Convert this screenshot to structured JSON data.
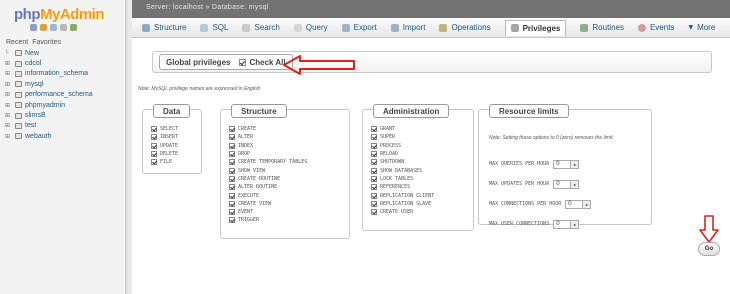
{
  "nav": {
    "logo": {
      "php": "php",
      "myadmin": "MyAdmin"
    },
    "tabs": {
      "recent": "Recent",
      "favorites": "Favorites"
    },
    "new_item": "New",
    "databases": [
      "cdcol",
      "information_schema",
      "mysql",
      "performance_schema",
      "phpmyadmin",
      "slimsB",
      "test",
      "webauth"
    ]
  },
  "breadcrumb": "Server: localhost » Database: mysql",
  "tabs": [
    {
      "label": "Structure",
      "icon": "structure-icon"
    },
    {
      "label": "SQL",
      "icon": "sql-icon"
    },
    {
      "label": "Search",
      "icon": "search-icon"
    },
    {
      "label": "Query",
      "icon": "query-icon"
    },
    {
      "label": "Export",
      "icon": "export-icon"
    },
    {
      "label": "Import",
      "icon": "import-icon"
    },
    {
      "label": "Operations",
      "icon": "operations-icon"
    },
    {
      "label": "Privileges",
      "icon": "privileges-icon"
    },
    {
      "label": "Routines",
      "icon": "routines-icon"
    },
    {
      "label": "Events",
      "icon": "events-icon"
    },
    {
      "label": "More",
      "icon": "more-icon"
    }
  ],
  "global_privileges": {
    "title": "Global privileges",
    "check_all": "Check All"
  },
  "note": "Note: MySQL privilege names are expressed in English",
  "groups": {
    "data": {
      "title": "Data",
      "items": [
        "SELECT",
        "INSERT",
        "UPDATE",
        "DELETE",
        "FILE"
      ]
    },
    "structure": {
      "title": "Structure",
      "items": [
        "CREATE",
        "ALTER",
        "INDEX",
        "DROP",
        "CREATE TEMPORARY TABLES",
        "SHOW VIEW",
        "CREATE ROUTINE",
        "ALTER ROUTINE",
        "EXECUTE",
        "CREATE VIEW",
        "EVENT",
        "TRIGGER"
      ]
    },
    "administration": {
      "title": "Administration",
      "items": [
        "GRANT",
        "SUPER",
        "PROCESS",
        "RELOAD",
        "SHUTDOWN",
        "SHOW DATABASES",
        "LOCK TABLES",
        "REFERENCES",
        "REPLICATION CLIENT",
        "REPLICATION SLAVE",
        "CREATE USER"
      ]
    }
  },
  "resource_limits": {
    "title": "Resource limits",
    "note": "Note: Setting these options to 0 (zero) removes the limit.",
    "items": [
      {
        "label": "MAX QUERIES PER HOUR",
        "value": "0"
      },
      {
        "label": "MAX UPDATES PER HOUR",
        "value": "0"
      },
      {
        "label": "MAX CONNECTIONS PER HOUR",
        "value": "0"
      },
      {
        "label": "MAX USER_CONNECTIONS",
        "value": "0"
      }
    ]
  },
  "go_label": "Go",
  "colors": {
    "annotation_arrow": "#d9231d",
    "link": "#235a81",
    "breadcrumb_bg": "#737373"
  }
}
